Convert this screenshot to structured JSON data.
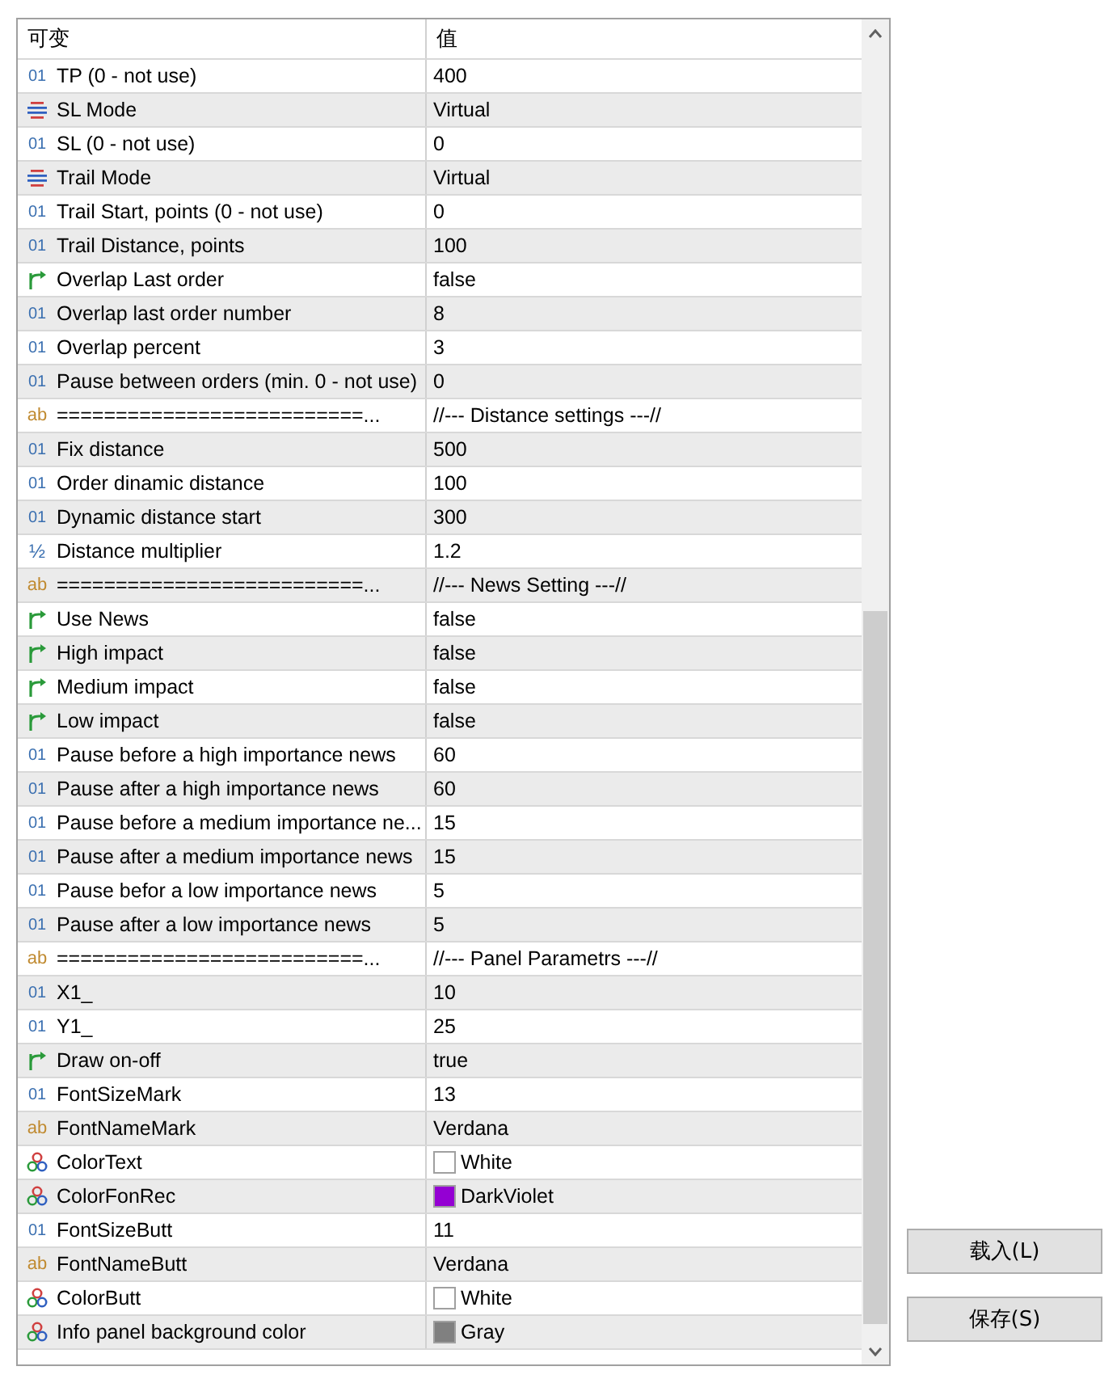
{
  "table": {
    "columns": [
      "可变",
      "值"
    ],
    "rows": [
      {
        "kind": "int",
        "icon_text": "01",
        "name": "TP (0 - not use)",
        "value": "400"
      },
      {
        "kind": "enum",
        "name": "SL Mode",
        "value": "Virtual"
      },
      {
        "kind": "int",
        "icon_text": "01",
        "name": "SL (0 - not use)",
        "value": "0"
      },
      {
        "kind": "enum",
        "name": "Trail Mode",
        "value": "Virtual"
      },
      {
        "kind": "int",
        "icon_text": "01",
        "name": "Trail Start, points (0 - not use)",
        "value": "0"
      },
      {
        "kind": "int",
        "icon_text": "01",
        "name": "Trail Distance, points",
        "value": "100"
      },
      {
        "kind": "bool",
        "name": "Overlap Last order",
        "value": "false"
      },
      {
        "kind": "int",
        "icon_text": "01",
        "name": "Overlap last order number",
        "value": "8"
      },
      {
        "kind": "int",
        "icon_text": "01",
        "name": "Overlap percent",
        "value": "3"
      },
      {
        "kind": "int",
        "icon_text": "01",
        "name": "Pause between orders (min. 0 - not use)",
        "value": "0"
      },
      {
        "kind": "string",
        "icon_text": "ab",
        "name": "==========================...",
        "value": "//--- Distance settings ---//"
      },
      {
        "kind": "int",
        "icon_text": "01",
        "name": "Fix distance",
        "value": "500"
      },
      {
        "kind": "int",
        "icon_text": "01",
        "name": "Order dinamic distance",
        "value": "100"
      },
      {
        "kind": "int",
        "icon_text": "01",
        "name": "Dynamic distance start",
        "value": "300"
      },
      {
        "kind": "double",
        "icon_text": "½",
        "name": "Distance multiplier",
        "value": "1.2"
      },
      {
        "kind": "string",
        "icon_text": "ab",
        "name": "==========================...",
        "value": "//--- News Setting ---//"
      },
      {
        "kind": "bool",
        "name": "Use News",
        "value": "false"
      },
      {
        "kind": "bool",
        "name": "High impact",
        "value": "false"
      },
      {
        "kind": "bool",
        "name": "Medium impact",
        "value": "false"
      },
      {
        "kind": "bool",
        "name": "Low impact",
        "value": "false"
      },
      {
        "kind": "int",
        "icon_text": "01",
        "name": "Pause before a high importance news",
        "value": "60"
      },
      {
        "kind": "int",
        "icon_text": "01",
        "name": "Pause after a high importance news",
        "value": "60"
      },
      {
        "kind": "int",
        "icon_text": "01",
        "name": "Pause before a medium importance ne...",
        "value": "15"
      },
      {
        "kind": "int",
        "icon_text": "01",
        "name": "Pause after a medium importance news",
        "value": "15"
      },
      {
        "kind": "int",
        "icon_text": "01",
        "name": "Pause befor a low importance news",
        "value": "5"
      },
      {
        "kind": "int",
        "icon_text": "01",
        "name": "Pause after a low importance news",
        "value": "5"
      },
      {
        "kind": "string",
        "icon_text": "ab",
        "name": "==========================...",
        "value": "//--- Panel Parametrs ---//"
      },
      {
        "kind": "int",
        "icon_text": "01",
        "name": "X1_",
        "value": "10"
      },
      {
        "kind": "int",
        "icon_text": "01",
        "name": "Y1_",
        "value": "25"
      },
      {
        "kind": "bool",
        "name": "Draw on-off",
        "value": "true"
      },
      {
        "kind": "int",
        "icon_text": "01",
        "name": "FontSizeMark",
        "value": "13"
      },
      {
        "kind": "string",
        "icon_text": "ab",
        "name": "FontNameMark",
        "value": "Verdana"
      },
      {
        "kind": "color",
        "name": "ColorText",
        "value": "White",
        "color": "#ffffff"
      },
      {
        "kind": "color",
        "name": "ColorFonRec",
        "value": "DarkViolet",
        "color": "#9400d3"
      },
      {
        "kind": "int",
        "icon_text": "01",
        "name": "FontSizeButt",
        "value": "11"
      },
      {
        "kind": "string",
        "icon_text": "ab",
        "name": "FontNameButt",
        "value": "Verdana"
      },
      {
        "kind": "color",
        "name": "ColorButt",
        "value": "White",
        "color": "#ffffff"
      },
      {
        "kind": "color",
        "name": "Info panel background color",
        "value": "Gray",
        "color": "#808080"
      }
    ]
  },
  "buttons": [
    "载入(L)",
    "保存(S)"
  ]
}
